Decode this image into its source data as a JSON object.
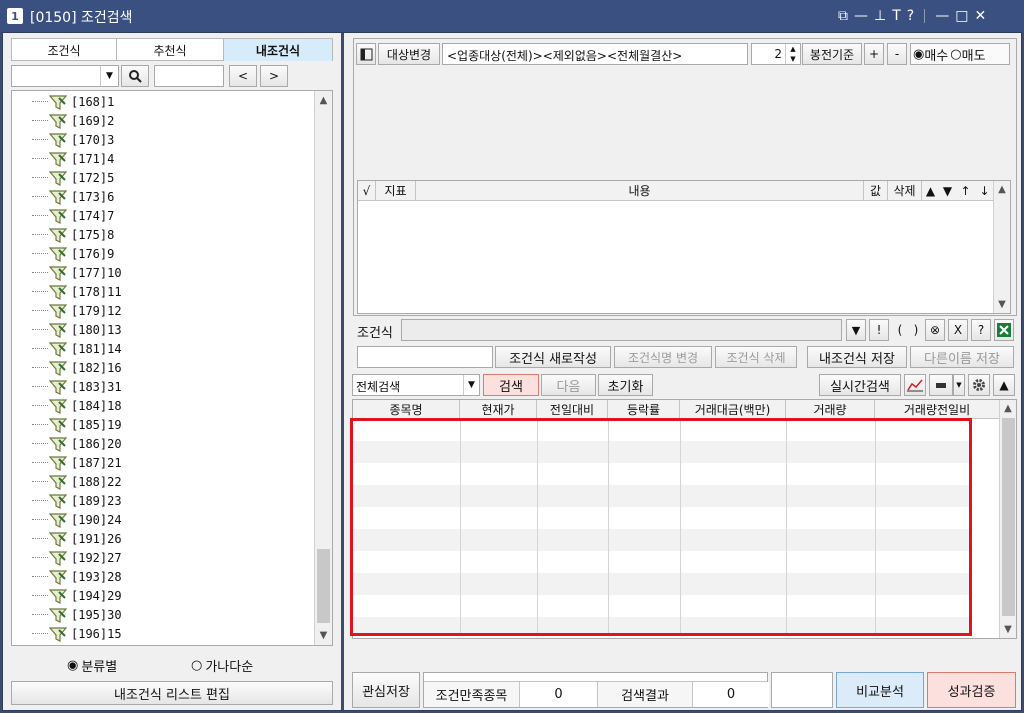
{
  "window": {
    "number_badge": "1",
    "title": "[0150] 조건검색",
    "controls": [
      "⧉",
      "—",
      "⊥",
      "T",
      "?",
      "—",
      "□",
      "✕"
    ]
  },
  "left_panel": {
    "tabs": [
      "조건식",
      "추천식",
      "내조건식"
    ],
    "active_tab": 2,
    "search_value": "",
    "search_placeholder": "",
    "nav_prev": "<",
    "nav_next": ">",
    "tree_items": [
      "[168]1",
      "[169]2",
      "[170]3",
      "[171]4",
      "[172]5",
      "[173]6",
      "[174]7",
      "[175]8",
      "[176]9",
      "[177]10",
      "[178]11",
      "[179]12",
      "[180]13",
      "[181]14",
      "[182]16",
      "[183]31",
      "[184]18",
      "[185]19",
      "[186]20",
      "[187]21",
      "[188]22",
      "[189]23",
      "[190]24",
      "[191]26",
      "[192]27",
      "[193]28",
      "[194]29",
      "[195]30",
      "[196]15"
    ],
    "sort_options": [
      "분류별",
      "가나다순"
    ],
    "sort_selected": 0,
    "edit_button": "내조건식 리스트 편집"
  },
  "top_toolbar": {
    "target_change_button": "대상변경",
    "target_text": "<업종대상(전체)><제외없음><전체월결산>",
    "bar_count": "2",
    "bar_basis_button": "봉전기준",
    "plus_button": "+",
    "minus_button": "-",
    "trade_options": [
      "매수",
      "매도"
    ],
    "trade_selected": 0
  },
  "condition_table": {
    "headers": [
      "√",
      "지표",
      "내용",
      "값",
      "삭제",
      "▲",
      "▼",
      "↑",
      "↓"
    ]
  },
  "condition_bar": {
    "label": "조건식",
    "value": "",
    "buttons": [
      "▼",
      "!",
      "(",
      ")",
      "⊗",
      "X",
      "?"
    ]
  },
  "condition_actions": {
    "name_value": "",
    "new_button": "조건식 새로작성",
    "rename_button": "조건식명 변경",
    "delete_button": "조건식 삭제",
    "save_button": "내조건식 저장",
    "save_as_button": "다른이름 저장"
  },
  "search_bar": {
    "mode_selected": "전체검색",
    "search_button": "검색",
    "next_button": "다음",
    "reset_button": "초기화",
    "realtime_button": "실시간검색"
  },
  "result_grid": {
    "headers": [
      "종목명",
      "현재가",
      "전일대비",
      "등락률",
      "거래대금(백만)",
      "거래량",
      "거래량전일비"
    ],
    "rows": [],
    "highlight_color": "#e0141e"
  },
  "bottom_bar": {
    "watch_save_button": "관심저장",
    "satisfy_label": "조건만족종목",
    "satisfy_count": "0",
    "result_label": "검색결과",
    "result_count": "0",
    "compare_button": "비교분석",
    "performance_button": "성과검증"
  }
}
